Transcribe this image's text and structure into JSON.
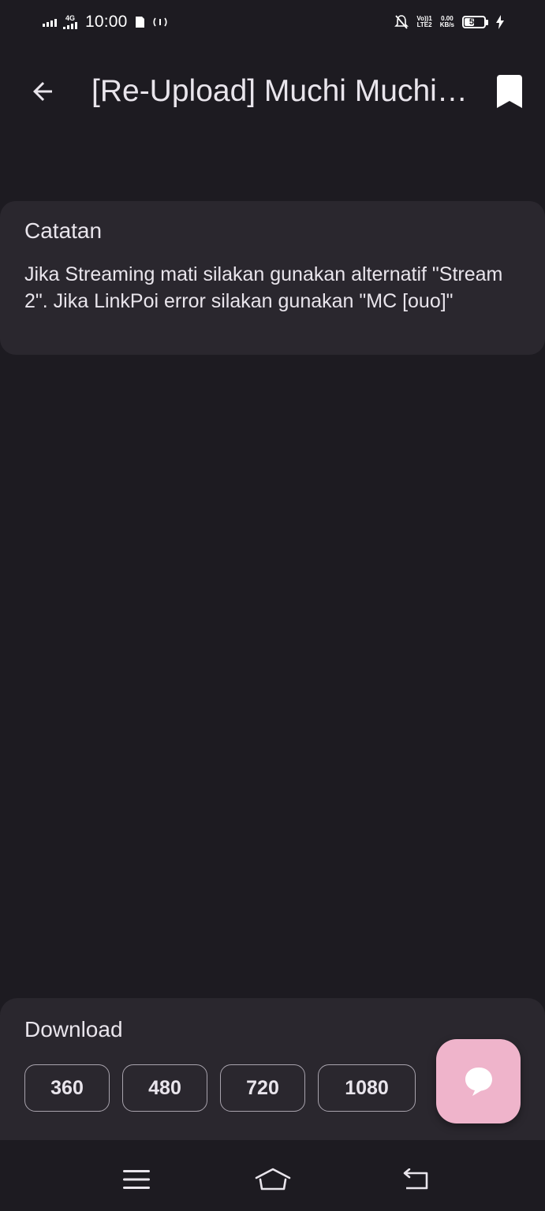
{
  "status_bar": {
    "time": "10:00",
    "network_type": "4G",
    "volte_line1": "Vo))1",
    "volte_line2": "LTE2",
    "speed_value": "0.00",
    "speed_unit": "KB/s",
    "battery_level": "52",
    "battery_fraction": 0.52
  },
  "app_bar": {
    "title": "[Re-Upload] Muchi Muchi Pork!"
  },
  "note": {
    "heading": "Catatan",
    "body": "Jika Streaming mati silakan gunakan alternatif \"Stream 2\". Jika LinkPoi error silakan gunakan \"MC [ouo]\""
  },
  "download": {
    "heading": "Download",
    "qualities": [
      "360",
      "480",
      "720",
      "1080"
    ]
  },
  "colors": {
    "background": "#1d1b21",
    "surface": "#2a272e",
    "accent": "#efb4cb",
    "text": "#e9e5ec"
  },
  "icons": {
    "back": "arrow-back-icon",
    "bookmark": "bookmark-icon",
    "chat": "chat-bubble-icon",
    "menu": "menu-lines-icon",
    "home": "home-icon",
    "back_nav": "return-icon"
  }
}
